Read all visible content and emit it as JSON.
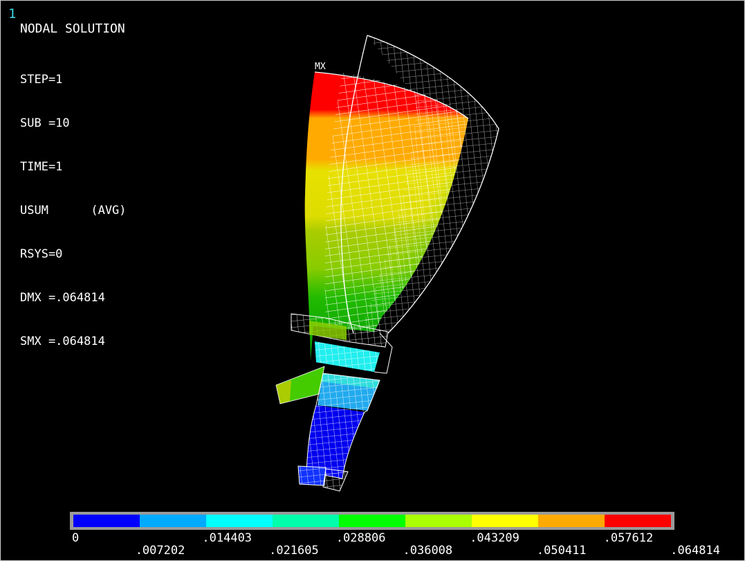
{
  "window_number": "1",
  "title": "NODAL SOLUTION",
  "info_lines": [
    "STEP=1",
    "SUB =10",
    "TIME=1",
    "USUM      (AVG)",
    "RSYS=0",
    "DMX =.064814",
    "SMX =.064814"
  ],
  "max_label": "MX",
  "legend": {
    "colors": [
      "#0000ff",
      "#00aaff",
      "#00ffff",
      "#00ffaa",
      "#00ff00",
      "#aaff00",
      "#ffff00",
      "#ffaa00",
      "#ff0000"
    ],
    "ticks": [
      "0",
      ".007202",
      ".014403",
      ".021605",
      ".028806",
      ".036008",
      ".043209",
      ".050411",
      ".057612",
      ".064814"
    ]
  }
}
